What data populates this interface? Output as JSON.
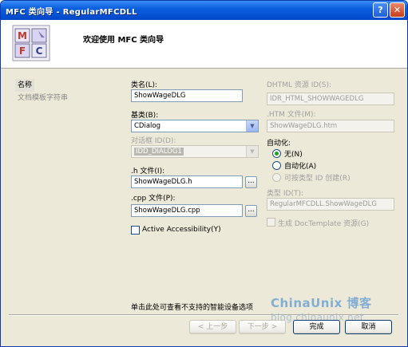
{
  "window": {
    "title": "MFC 类向导 - RegularMFCDLL",
    "help_glyph": "?",
    "close_glyph": "✕"
  },
  "header": {
    "title": "欢迎使用 MFC 类向导",
    "logo_letters": [
      "M",
      "F",
      "C"
    ]
  },
  "sidebar": {
    "items": [
      {
        "label": "名称"
      },
      {
        "label": "文档模板字符串"
      }
    ]
  },
  "form": {
    "class_name": {
      "label": "类名(L):",
      "value": "ShowWageDLG"
    },
    "base_class": {
      "label": "基类(B):",
      "value": "CDialog"
    },
    "dialog_id": {
      "label": "对话框 ID(D):",
      "value": "IDD_DIALOG1"
    },
    "h_file": {
      "label": ".h 文件(I):",
      "value": "ShowWageDLG.h",
      "browse": "..."
    },
    "cpp_file": {
      "label": ".cpp 文件(P):",
      "value": "ShowWageDLG.cpp",
      "browse": "..."
    },
    "active_accessibility": {
      "label": "Active Accessibility(Y)",
      "checked": false
    },
    "dhtml_resource_id": {
      "label": "DHTML 资源 ID(S):",
      "value": "IDR_HTML_SHOWWAGEDLG"
    },
    "htm_file": {
      "label": ".HTM 文件(M):",
      "value": "ShowWageDLG.htm"
    },
    "automation": {
      "label": "自动化:",
      "options": [
        {
          "label": "无(N)",
          "checked": true,
          "enabled": true
        },
        {
          "label": "自动化(A)",
          "checked": false,
          "enabled": true
        },
        {
          "label": "可按类型 ID 创建(R)",
          "checked": false,
          "enabled": false
        }
      ]
    },
    "type_id": {
      "label": "类型 ID(T):",
      "value": "RegularMFCDLL.ShowWageDLG"
    },
    "doctemplate": {
      "label": "生成 DocTemplate 资源(G)",
      "checked": false
    }
  },
  "footer": {
    "note": "单击此处可查看不支持的智能设备选项",
    "buttons": {
      "back": "< 上一步",
      "next": "下一步 >",
      "finish": "完成",
      "cancel": "取消"
    }
  },
  "watermark": {
    "main": "ChinaUnix 博客",
    "sub": "blog.chinaunix.net"
  }
}
